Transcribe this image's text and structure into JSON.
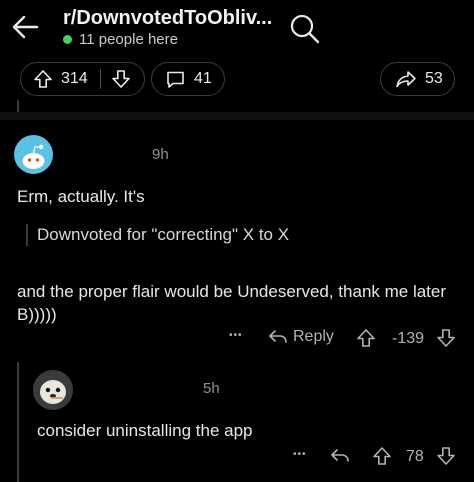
{
  "header": {
    "subreddit": "r/DownvotedToObliv...",
    "online_text": "11 people here",
    "online_dot_color": "#46d160"
  },
  "post_actions": {
    "upvotes": "314",
    "comments": "41",
    "shares": "53"
  },
  "comment": {
    "time": "9h",
    "line1": "Erm, actually. It's",
    "quote": "Downvoted for \"correcting\" X to X",
    "line2": "and the proper flair would be Undeserved, thank me later B)))))",
    "more": "•••",
    "reply_label": "Reply",
    "score": "-139"
  },
  "reply": {
    "time": "5h",
    "text": "consider uninstalling the app",
    "more": "•••",
    "score": "78"
  }
}
